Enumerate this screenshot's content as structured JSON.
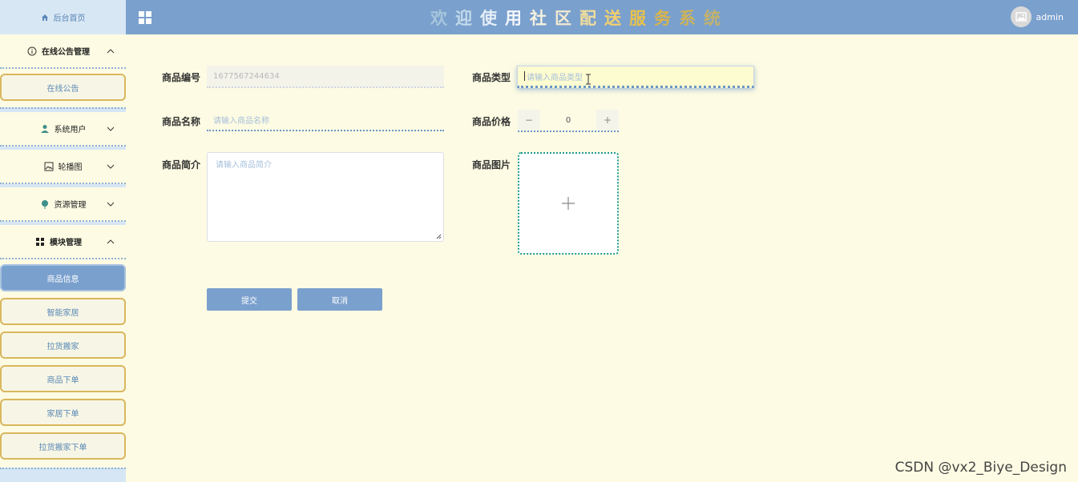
{
  "sidebar": {
    "home": "后台首页",
    "groups": [
      {
        "label": "在线公告管理",
        "sub": [
          "在线公告"
        ]
      },
      {
        "label": "系统用户"
      },
      {
        "label": "轮播图"
      },
      {
        "label": "资源管理"
      },
      {
        "label": "模块管理",
        "sub": [
          "商品信息",
          "智能家居",
          "拉货搬家",
          "商品下单",
          "家居下单",
          "拉货搬家下单"
        ]
      }
    ],
    "active_item": "商品信息"
  },
  "header": {
    "title_chars": [
      "欢",
      "迎",
      "使",
      "用",
      "社",
      "区",
      "配",
      "送",
      "服",
      "务",
      "系",
      "统"
    ],
    "title_colors": [
      "#a7c6dd",
      "#c2d9ea",
      "#e4eef7",
      "#f3f6fb",
      "#f5f2e0",
      "#f3ead0",
      "#f0dd9b",
      "#f2cf6e",
      "#e8c24d",
      "#d9b54c",
      "#cdb35a",
      "#c2b26e"
    ],
    "user": "admin"
  },
  "form": {
    "code_label": "商品编号",
    "code_value": "1677567244634",
    "type_label": "商品类型",
    "type_placeholder": "请输入商品类型",
    "name_label": "商品名称",
    "name_placeholder": "请输入商品名称",
    "price_label": "商品价格",
    "price_value": "0",
    "intro_label": "商品简介",
    "intro_placeholder": "请输入商品简介",
    "image_label": "商品图片",
    "submit": "提交",
    "cancel": "取消"
  },
  "watermark": "CSDN @vx2_Biye_Design",
  "colors": {
    "accent": "#7aa0cd",
    "background": "#fdfbe3",
    "border_gold": "#d9b75d"
  }
}
